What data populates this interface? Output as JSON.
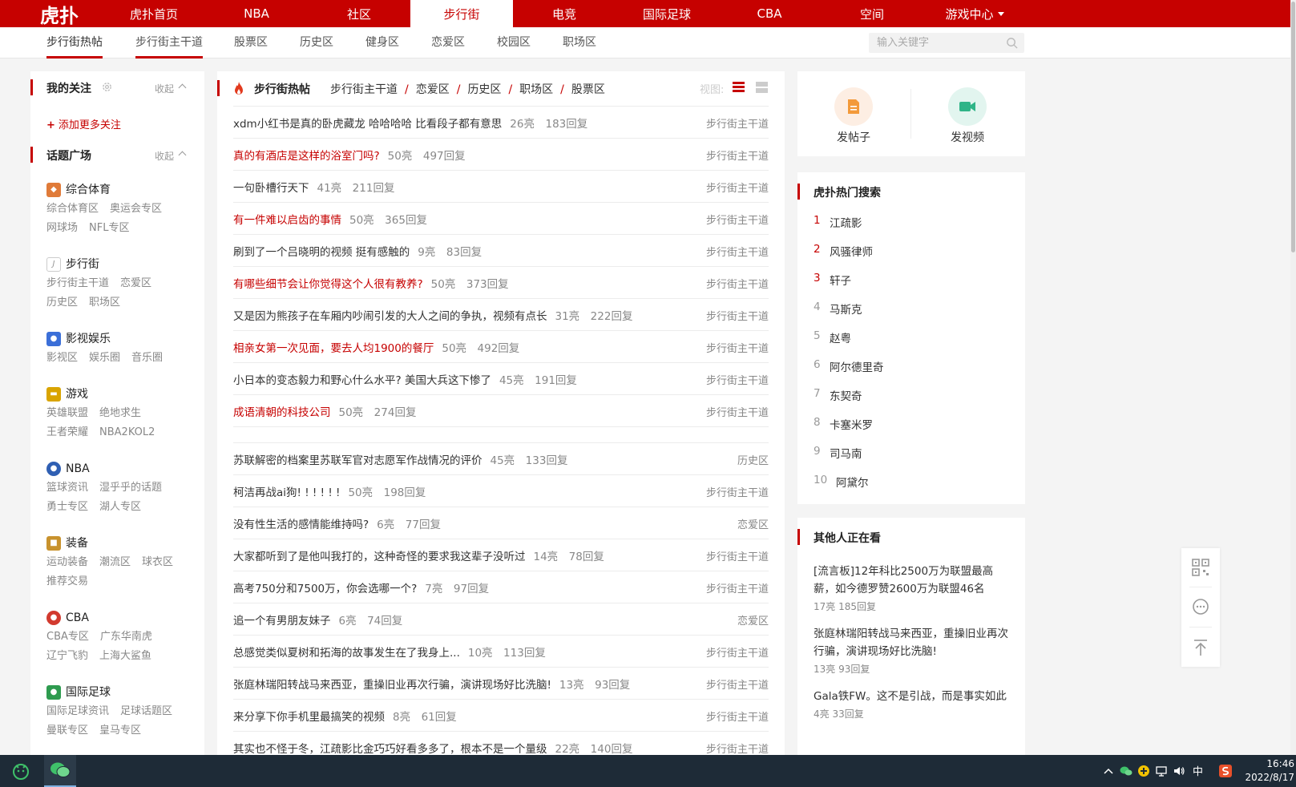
{
  "topnav": {
    "logo": "虎扑",
    "items": [
      "虎扑首页",
      "NBA",
      "社区",
      "步行街",
      "电竞",
      "国际足球",
      "CBA",
      "空间",
      "游戏中心"
    ],
    "active_index": 3
  },
  "subnav": {
    "items": [
      "步行街热帖",
      "步行街主干道",
      "股票区",
      "历史区",
      "健身区",
      "恋爱区",
      "校园区",
      "职场区"
    ],
    "search_placeholder": "输入关键字"
  },
  "sidebar": {
    "follow_title": "我的关注",
    "fold_label": "收起",
    "add_follow": "添加更多关注",
    "topic_title": "话题广场",
    "categories": [
      {
        "name": "综合体育",
        "links": [
          "综合体育区",
          "奥运会专区",
          "网球场",
          "NFL专区"
        ],
        "icon_color": "#e07b39",
        "icon": "sports-icon"
      },
      {
        "name": "步行街",
        "links": [
          "步行街主干道",
          "恋爱区",
          "历史区",
          "职场区"
        ],
        "icon_color": "#9a9a9a",
        "icon": "street-icon"
      },
      {
        "name": "影视娱乐",
        "links": [
          "影视区",
          "娱乐圈",
          "音乐圈"
        ],
        "icon_color": "#3b6fd8",
        "icon": "popcorn-icon"
      },
      {
        "name": "游戏",
        "links": [
          "英雄联盟",
          "绝地求生",
          "王者荣耀",
          "NBA2KOL2"
        ],
        "icon_color": "#d9a400",
        "icon": "gamepad-icon"
      },
      {
        "name": "NBA",
        "links": [
          "篮球资讯",
          "湿乎乎的话题",
          "勇士专区",
          "湖人专区"
        ],
        "icon_color": "#2f5fb3",
        "icon": "nba-icon"
      },
      {
        "name": "装备",
        "links": [
          "运动装备",
          "潮流区",
          "球衣区",
          "推荐交易"
        ],
        "icon_color": "#c8922d",
        "icon": "gear-bag-icon"
      },
      {
        "name": "CBA",
        "links": [
          "CBA专区",
          "广东华南虎",
          "辽宁飞豹",
          "上海大鲨鱼"
        ],
        "icon_color": "#d23a2f",
        "icon": "basketball-icon"
      },
      {
        "name": "国际足球",
        "links": [
          "国际足球资讯",
          "足球话题区",
          "曼联专区",
          "皇马专区"
        ],
        "icon_color": "#2e9b4f",
        "icon": "football-icon"
      }
    ]
  },
  "center": {
    "title": "步行街热帖",
    "crumbs": [
      "步行街主干道",
      "恋爱区",
      "历史区",
      "职场区",
      "股票区"
    ],
    "view_label": "视图:",
    "group1": [
      {
        "title": "xdm小红书是真的卧虎藏龙 哈哈哈哈 比看段子都有意思",
        "stat": "26亮　183回复",
        "board": "步行街主干道",
        "red": false
      },
      {
        "title": "真的有酒店是这样的浴室门吗?",
        "stat": "50亮　497回复",
        "board": "步行街主干道",
        "red": true
      },
      {
        "title": "一句卧槽行天下",
        "stat": "41亮　211回复",
        "board": "步行街主干道",
        "red": false
      },
      {
        "title": "有一件难以启齿的事情",
        "stat": "50亮　365回复",
        "board": "步行街主干道",
        "red": true
      },
      {
        "title": "刷到了一个吕晓明的视频 挺有感触的",
        "stat": "9亮　83回复",
        "board": "步行街主干道",
        "red": false
      },
      {
        "title": "有哪些细节会让你觉得这个人很有教养?",
        "stat": "50亮　373回复",
        "board": "步行街主干道",
        "red": true
      },
      {
        "title": "又是因为熊孩子在车厢内吵闹引发的大人之间的争执，视频有点长",
        "stat": "31亮　222回复",
        "board": "步行街主干道",
        "red": false
      },
      {
        "title": "相亲女第一次见面，要去人均1900的餐厅",
        "stat": "50亮　492回复",
        "board": "步行街主干道",
        "red": true
      },
      {
        "title": "小日本的变态毅力和野心什么水平? 美国大兵这下惨了",
        "stat": "45亮　191回复",
        "board": "步行街主干道",
        "red": false
      },
      {
        "title": "成语清朝的科技公司",
        "stat": "50亮　274回复",
        "board": "步行街主干道",
        "red": true
      }
    ],
    "group2": [
      {
        "title": "苏联解密的档案里苏联军官对志愿军作战情况的评价",
        "stat": "45亮　133回复",
        "board": "历史区",
        "red": false
      },
      {
        "title": "柯洁再战ai狗! ! ! ! ! !",
        "stat": "50亮　198回复",
        "board": "步行街主干道",
        "red": false
      },
      {
        "title": "没有性生活的感情能维持吗?",
        "stat": "6亮　77回复",
        "board": "恋爱区",
        "red": false
      },
      {
        "title": "大家都听到了是他叫我打的，这种奇怪的要求我这辈子没听过",
        "stat": "14亮　78回复",
        "board": "步行街主干道",
        "red": false
      },
      {
        "title": "高考750分和7500万，你会选哪一个?",
        "stat": "7亮　97回复",
        "board": "步行街主干道",
        "red": false
      },
      {
        "title": "追一个有男朋友妹子",
        "stat": "6亮　74回复",
        "board": "恋爱区",
        "red": false
      },
      {
        "title": "总感觉类似夏树和拓海的故事发生在了我身上...",
        "stat": "10亮　113回复",
        "board": "步行街主干道",
        "red": false
      },
      {
        "title": "张庭林瑞阳转战马来西亚，重操旧业再次行骗，演讲现场好比洗脑!",
        "stat": "13亮　93回复",
        "board": "步行街主干道",
        "red": false
      },
      {
        "title": "来分享下你手机里最搞笑的视频",
        "stat": "8亮　61回复",
        "board": "步行街主干道",
        "red": false
      },
      {
        "title": "其实也不怪于冬，江疏影比金巧巧好看多多了，根本不是一个量级",
        "stat": "22亮　140回复",
        "board": "步行街主干道",
        "red": false
      }
    ]
  },
  "publish": {
    "post_label": "发帖子",
    "video_label": "发视频"
  },
  "hot_search": {
    "title": "虎扑热门搜索",
    "items": [
      "江疏影",
      "风骚律师",
      "轩子",
      "马斯克",
      "赵粤",
      "阿尔德里奇",
      "东契奇",
      "卡塞米罗",
      "司马南",
      "阿黛尔"
    ]
  },
  "watching": {
    "title": "其他人正在看",
    "items": [
      {
        "title": "[流言板]12年科比2500万为联盟最高薪，如今德罗赞2600万为联盟46名",
        "stat": "17亮 185回复"
      },
      {
        "title": "张庭林瑞阳转战马来西亚，重操旧业再次行骗，演讲现场好比洗脑!",
        "stat": "13亮 93回复"
      },
      {
        "title": "Gala铁FW。这不是引战，而是事实如此",
        "stat": "4亮 33回复"
      }
    ]
  },
  "taskbar": {
    "ime": "中",
    "time": "16:46",
    "date": "2022/8/17"
  },
  "colors": {
    "brand": "#c60100"
  }
}
